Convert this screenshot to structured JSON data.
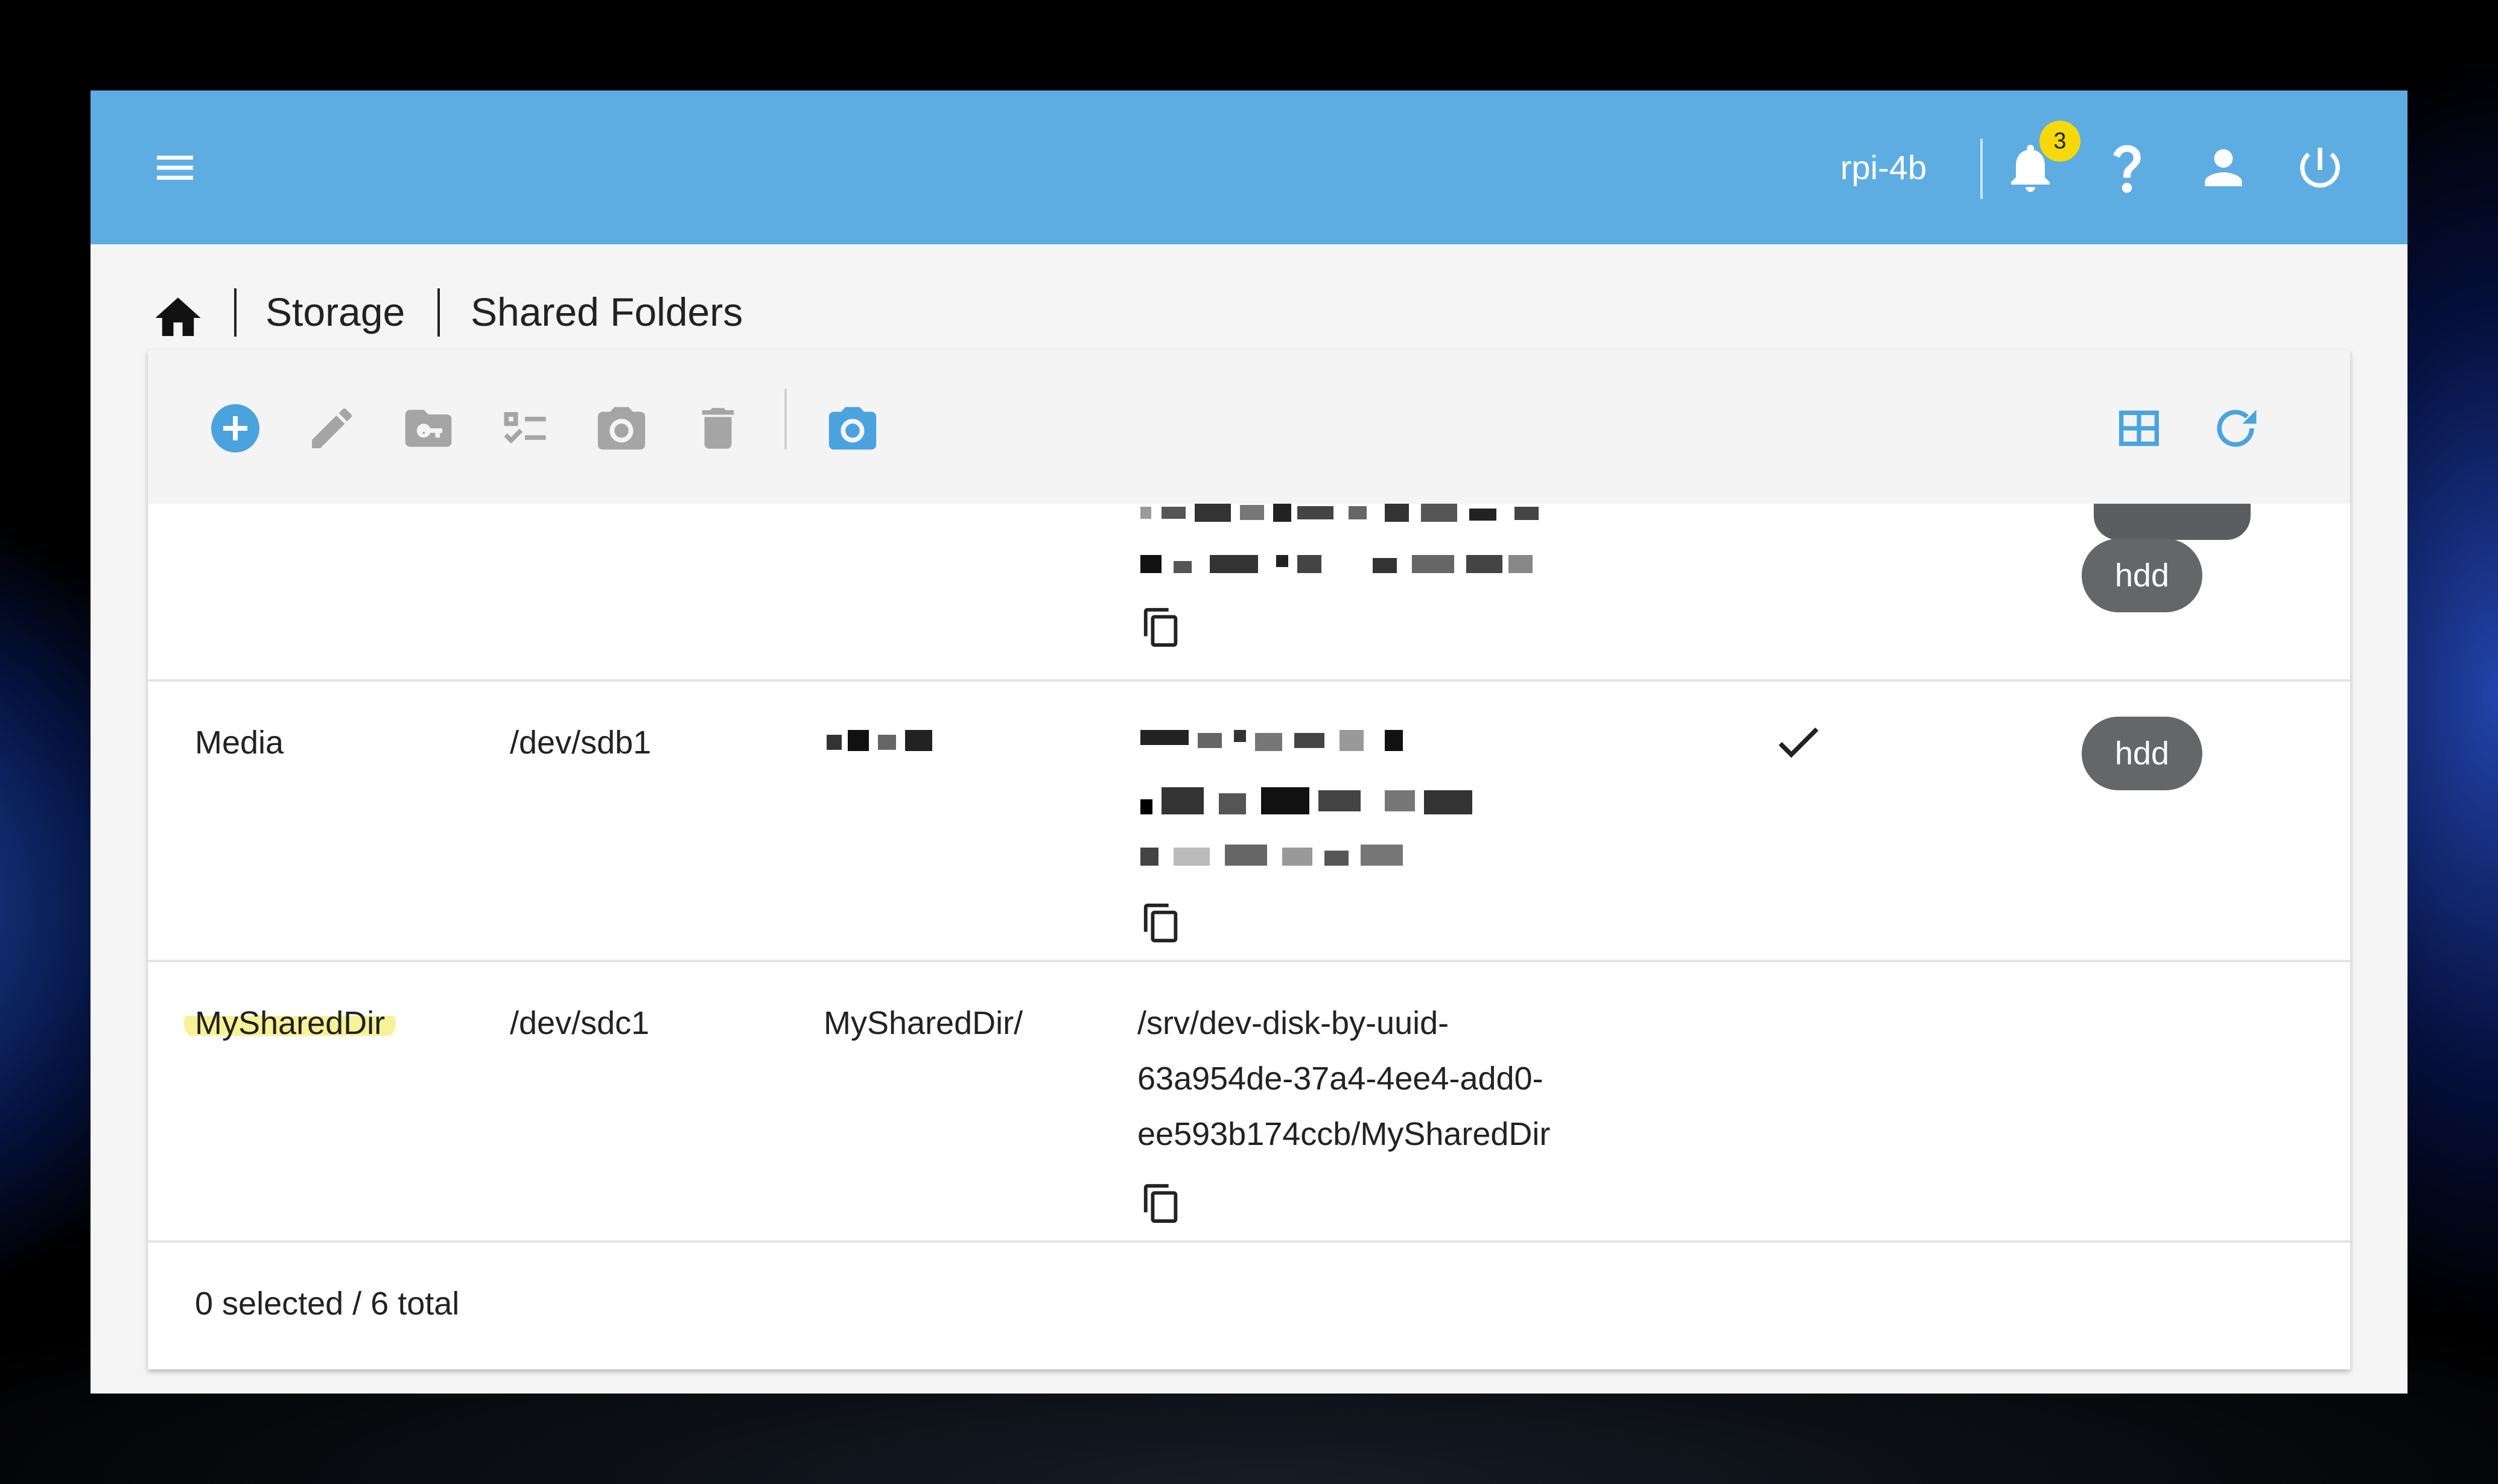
{
  "topbar": {
    "hostname": "rpi-4b",
    "notification_count": "3",
    "accent_color": "#5dade2",
    "badge_color": "#f5d90a"
  },
  "breadcrumb": {
    "items": [
      "Storage",
      "Shared Folders"
    ]
  },
  "toolbar": {
    "icons": [
      "add-icon",
      "edit-icon",
      "permissions-icon",
      "acl-icon",
      "snapshot-icon",
      "delete-icon",
      "snapshot-list-icon",
      "table-view-icon",
      "refresh-icon"
    ]
  },
  "rows": [
    {
      "name": "",
      "device": "",
      "relative_path": "",
      "absolute_path": "",
      "tag": "hdd"
    },
    {
      "name": "Media",
      "device": "/dev/sdb1",
      "relative_path": "",
      "absolute_path": "",
      "referenced": "✓",
      "tag": "hdd"
    },
    {
      "name": "MySharedDir",
      "device": "/dev/sdc1",
      "relative_path": "MySharedDir/",
      "absolute_path_lines": [
        "/srv/dev-disk-by-uuid-",
        "63a954de-37a4-4ee4-add0-",
        "ee593b174ccb/MySharedDir"
      ],
      "tag": ""
    }
  ],
  "footer": {
    "summary": "0 selected / 6 total"
  }
}
